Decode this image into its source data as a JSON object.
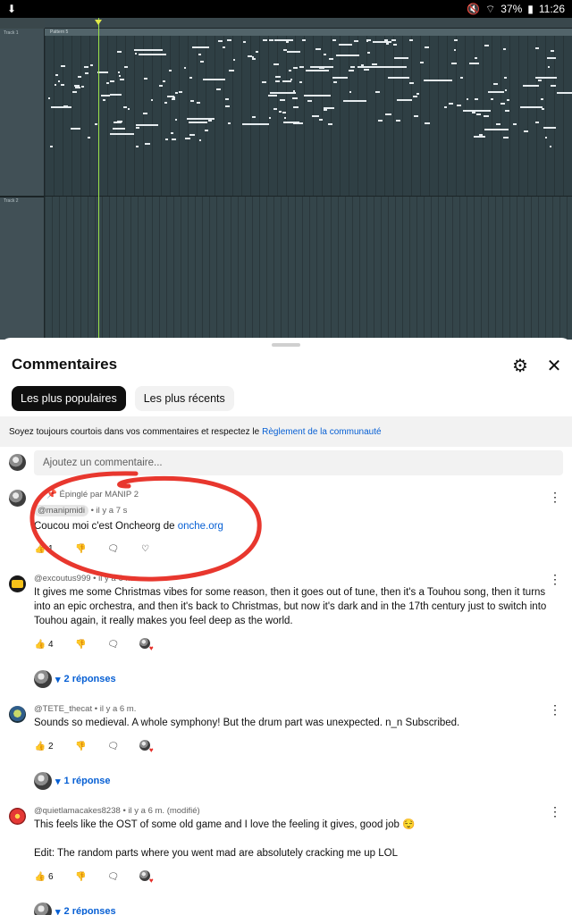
{
  "statusbar": {
    "battery": "37%",
    "time": "11:26"
  },
  "daw": {
    "track1_label": "Track 1",
    "track2_label": "Track 2",
    "pattern_label": "Pattern 5"
  },
  "sheet": {
    "title": "Commentaires",
    "chips": [
      "Les plus populaires",
      "Les plus récents"
    ],
    "notice_text": "Soyez toujours courtois dans vos commentaires et respectez le",
    "notice_link": "Règlement de la communauté",
    "add_placeholder": "Ajoutez un commentaire..."
  },
  "comments": [
    {
      "pinned": "Épinglé par MANIP 2",
      "author": "@manipmidi",
      "time": "il y a 7 s",
      "text": "Coucou moi c'est Oncheorg de",
      "link": "onche.org",
      "likes": "1"
    },
    {
      "author": "@excoutus999",
      "time": "il y a 6 m.",
      "text": "It gives me some Christmas vibes for some reason, then it goes out of tune, then it's a Touhou song, then it turns into an epic orchestra, and then it's back to Christmas, but now it's dark and in the 17th century just to switch into Touhou again, it really makes you feel deep as the world.",
      "likes": "4",
      "replies": "2 réponses"
    },
    {
      "author": "@TETE_thecat",
      "time": "il y a 6 m.",
      "text": "Sounds so medieval. A whole symphony!  But the drum part was unexpected. n_n Subscribed.",
      "likes": "2",
      "replies": "1 réponse"
    },
    {
      "author": "@quietlamacakes8238",
      "time": "il y a 6 m. (modifié)",
      "text": "This feels like the OST of some old game and I love the feeling it gives, good job 😌",
      "text2": "Edit: The random parts where you went mad are absolutely cracking me  up LOL",
      "likes": "6",
      "replies": "2 réponses"
    }
  ],
  "colors": {
    "link": "#065fd4",
    "annotation_circle": "#e8372e"
  }
}
